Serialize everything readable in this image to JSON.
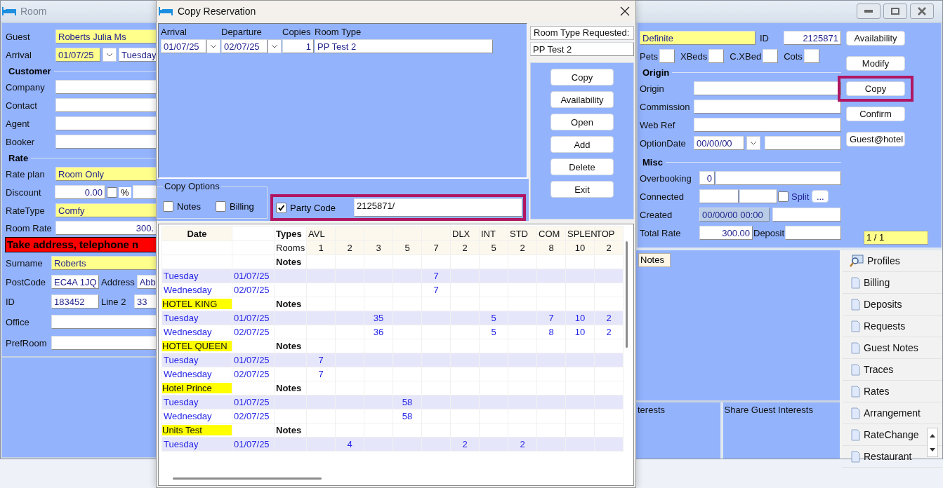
{
  "room_window": {
    "title": "Room",
    "guest": {
      "label": "Guest",
      "value": "Roberts Julia Ms"
    },
    "arrival": {
      "label": "Arrival",
      "value": "01/07/25",
      "day": "Tuesday"
    },
    "customer": {
      "title": "Customer",
      "fields": [
        {
          "label": "Company"
        },
        {
          "label": "Contact"
        },
        {
          "label": "Agent"
        },
        {
          "label": "Booker"
        }
      ]
    },
    "rate": {
      "title": "Rate",
      "rate_plan": {
        "label": "Rate plan",
        "value": "Room Only"
      },
      "discount": {
        "label": "Discount",
        "value": "0.00",
        "percent_checked": false,
        "percent_label": "%"
      },
      "rate_type": {
        "label": "RateType",
        "value": "Comfy"
      },
      "room_rate": {
        "label": "Room Rate",
        "value": "300."
      }
    },
    "alert": "Take address, telephone n",
    "surname": {
      "label": "Surname",
      "value": "Roberts"
    },
    "postcode": {
      "label": "PostCode",
      "value": "EC4A 1JQ",
      "side_label": "Address",
      "side_value": "Abb"
    },
    "guest_id": {
      "label": "ID",
      "value": "183452",
      "side_label": "Line 2",
      "side_value": "33"
    },
    "office": {
      "label": "Office"
    },
    "pref_room": {
      "label": "PrefRoom"
    },
    "status": "Definite",
    "reservation_id": {
      "label": "ID",
      "value": "2125871"
    },
    "extras": [
      {
        "label": "Pets"
      },
      {
        "label": "XBeds"
      },
      {
        "label": "C.XBed"
      },
      {
        "label": "Cots"
      }
    ],
    "origin": {
      "title": "Origin",
      "fields": [
        {
          "label": "Origin"
        },
        {
          "label": "Commission"
        },
        {
          "label": "Web Ref"
        }
      ],
      "option_date": {
        "label": "OptionDate",
        "value": "00/00/00"
      }
    },
    "misc": {
      "title": "Misc",
      "overbooking": {
        "label": "Overbooking",
        "value": "0"
      },
      "connected": {
        "label": "Connected",
        "split_label": "Split",
        "split_checked": false,
        "more": "..."
      },
      "created": {
        "label": "Created",
        "value": "00/00/00 00:00"
      },
      "total_rate": {
        "label": "Total Rate",
        "value": "300.00",
        "deposit_label": "Deposit"
      }
    },
    "actions": [
      {
        "label": "Availability",
        "highlighted": false
      },
      {
        "label": "Modify",
        "highlighted": false
      },
      {
        "label": "Copy",
        "highlighted": true
      },
      {
        "label": "Confirm",
        "highlighted": false
      },
      {
        "label": "Guest@hotel",
        "highlighted": false
      }
    ],
    "pager": "1 / 1",
    "notes_tab": "Notes",
    "interests": [
      "terests",
      "Share Guest Interests"
    ],
    "side_menu": [
      {
        "label": "Profiles",
        "kind": "search"
      },
      {
        "label": "Billing",
        "kind": "page"
      },
      {
        "label": "Deposits",
        "kind": "page"
      },
      {
        "label": "Requests",
        "kind": "page"
      },
      {
        "label": "Guest Notes",
        "kind": "page"
      },
      {
        "label": "Traces",
        "kind": "page"
      },
      {
        "label": "Rates",
        "kind": "page"
      },
      {
        "label": "Arrangement",
        "kind": "page"
      },
      {
        "label": "RateChange",
        "kind": "page"
      },
      {
        "label": "Restaurant",
        "kind": "page"
      }
    ]
  },
  "dialog": {
    "title": "Copy Reservation",
    "arrival": {
      "label": "Arrival",
      "value": "01/07/25"
    },
    "departure": {
      "label": "Departure",
      "value": "02/07/25"
    },
    "copies": {
      "label": "Copies",
      "value": "1"
    },
    "room_type": {
      "label": "Room Type",
      "value": "PP Test 2"
    },
    "requested": {
      "label": "Room Type Requested:",
      "value": "PP Test 2"
    },
    "buttons": [
      "Copy",
      "Availability",
      "Open",
      "Add",
      "Delete",
      "Exit"
    ],
    "copy_options": {
      "title": "Copy Options",
      "options": [
        {
          "label": "Notes",
          "checked": false
        },
        {
          "label": "Billing",
          "checked": false
        }
      ],
      "party_code": {
        "label": "Party Code",
        "checked": true,
        "value": "2125871/",
        "highlighted": true
      }
    },
    "table": {
      "date_header": "Date",
      "types_label": "Types",
      "rooms_label": "Rooms",
      "columns": [
        {
          "type": "AVL",
          "rooms": "1"
        },
        {
          "rooms": "2"
        },
        {
          "rooms": "3"
        },
        {
          "rooms": "5"
        },
        {
          "rooms": "7"
        },
        {
          "type": "DLX",
          "rooms": "2"
        },
        {
          "type": "INT",
          "rooms": "5"
        },
        {
          "type": "STD",
          "rooms": "2"
        },
        {
          "type": "COM",
          "rooms": "8"
        },
        {
          "type": "SPLEN",
          "rooms": "10"
        },
        {
          "type": "TOP",
          "rooms": "2"
        }
      ],
      "groups": [
        {
          "notes_label": "Notes",
          "rows": [
            {
              "day": "Tuesday",
              "date": "01/07/25",
              "values": {
                "c5": "7"
              }
            },
            {
              "day": "Wednesday",
              "date": "02/07/25",
              "values": {
                "c5": "7"
              }
            }
          ]
        },
        {
          "name": "HOTEL KING",
          "notes_label": "Notes",
          "rows": [
            {
              "day": "Tuesday",
              "date": "01/07/25",
              "values": {
                "c3": "35",
                "c7": "5",
                "c9": "7",
                "c10": "10",
                "c11": "2"
              }
            },
            {
              "day": "Wednesday",
              "date": "02/07/25",
              "values": {
                "c3": "36",
                "c7": "5",
                "c9": "8",
                "c10": "10",
                "c11": "2"
              }
            }
          ]
        },
        {
          "name": "HOTEL QUEEN",
          "notes_label": "Notes",
          "rows": [
            {
              "day": "Tuesday",
              "date": "01/07/25",
              "values": {
                "c1": "7"
              }
            },
            {
              "day": "Wednesday",
              "date": "02/07/25",
              "values": {
                "c1": "7"
              }
            }
          ]
        },
        {
          "name": "Hotel Prince",
          "notes_label": "Notes",
          "rows": [
            {
              "day": "Tuesday",
              "date": "01/07/25",
              "values": {
                "c4": "58"
              }
            },
            {
              "day": "Wednesday",
              "date": "02/07/25",
              "values": {
                "c4": "58"
              }
            }
          ]
        },
        {
          "name": "Units Test",
          "notes_label": "Notes",
          "rows": [
            {
              "day": "Tuesday",
              "date": "01/07/25",
              "values": {
                "c2": "4",
                "c6": "2",
                "c8": "2"
              }
            }
          ]
        }
      ]
    }
  }
}
